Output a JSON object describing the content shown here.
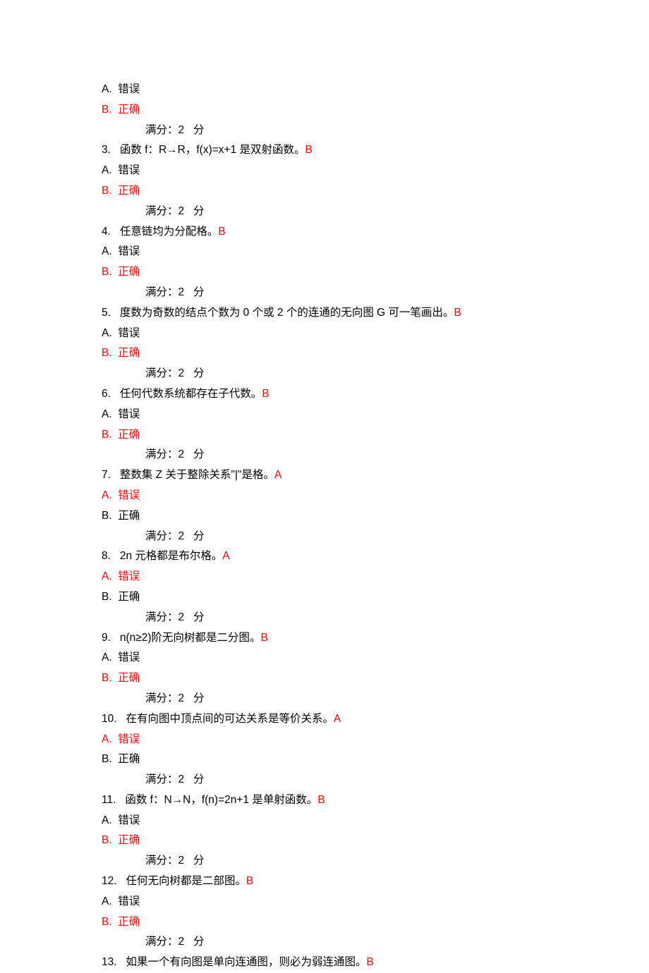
{
  "colors": {
    "answer": "#ff0000",
    "text": "#000000"
  },
  "score_line": "满分：2   分",
  "intro": {
    "optA": "A.  错误",
    "optB": "B.  正确"
  },
  "questions": [
    {
      "num": "3.",
      "text": "函数 f：R→R，f(x)=x+1 是双射函数。",
      "key": "B",
      "optA": "A.  错误",
      "optB": "B.  正确",
      "correct": "B"
    },
    {
      "num": "4.",
      "text": "任意链均为分配格。",
      "key": "B",
      "optA": "A.  错误",
      "optB": "B.  正确",
      "correct": "B"
    },
    {
      "num": "5.",
      "text": "度数为奇数的结点个数为 0 个或 2 个的连通的无向图 G 可一笔画出。",
      "key": "B",
      "optA": "A.  错误",
      "optB": "B.  正确",
      "correct": "B"
    },
    {
      "num": "6.",
      "text": "任何代数系统都存在子代数。",
      "key": "B",
      "optA": "A.  错误",
      "optB": "B.  正确",
      "correct": "B"
    },
    {
      "num": "7.",
      "text": "整数集 Z 关于整除关系\"|\"是格。",
      "key": "A",
      "optA": "A.  错误",
      "optB": "B.  正确",
      "correct": "A"
    },
    {
      "num": "8.",
      "text": "2n 元格都是布尔格。",
      "key": "A",
      "optA": "A.  错误",
      "optB": "B.  正确",
      "correct": "A"
    },
    {
      "num": "9.",
      "text": "n(n≥2)阶无向树都是二分图。",
      "key": "B",
      "optA": "A.  错误",
      "optB": "B.  正确",
      "correct": "B"
    },
    {
      "num": "10.",
      "text": "在有向图中顶点间的可达关系是等价关系。",
      "key": "A",
      "optA": "A.  错误",
      "optB": "B.  正确",
      "correct": "A"
    },
    {
      "num": "11.",
      "text": "函数 f：N→N，f(n)=2n+1 是单射函数。",
      "key": "B",
      "optA": "A.  错误",
      "optB": "B.  正确",
      "correct": "B"
    },
    {
      "num": "12.",
      "text": "任何无向树都是二部图。",
      "key": "B",
      "optA": "A.  错误",
      "optB": "B.  正确",
      "correct": "B"
    },
    {
      "num": "13.",
      "text": "如果一个有向图是单向连通图，则必为弱连通图。",
      "key": "B",
      "trailing": true
    }
  ]
}
